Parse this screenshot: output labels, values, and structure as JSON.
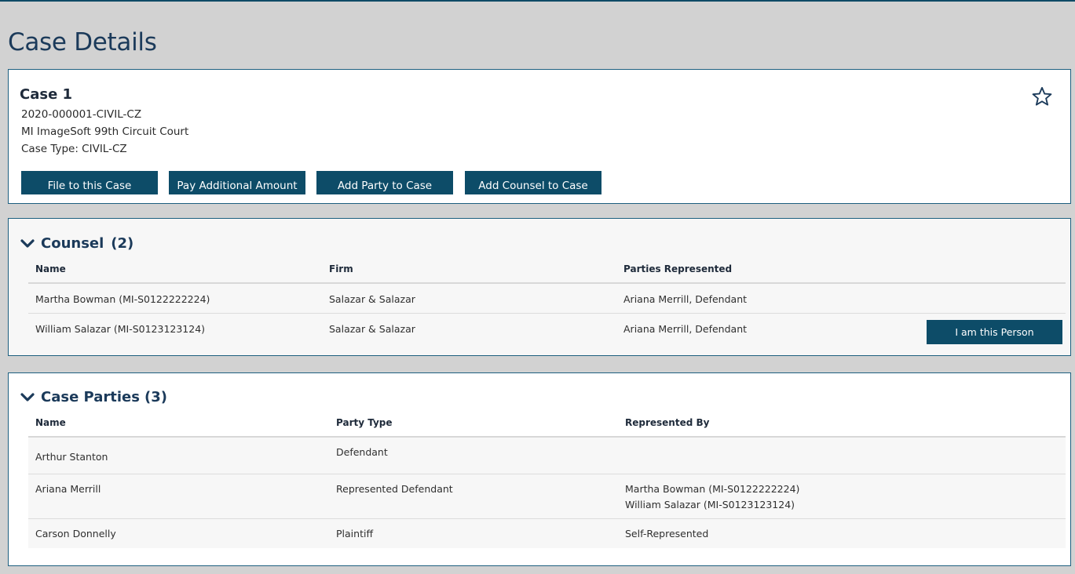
{
  "page": {
    "title": "Case Details"
  },
  "case": {
    "name": "Case 1",
    "number": "2020-000001-CIVIL-CZ",
    "court": "MI ImageSoft 99th Circuit Court",
    "type": "Case Type: CIVIL-CZ",
    "favorite_icon": "star-outline-icon",
    "actions": {
      "file": "File to this Case",
      "pay": "Pay Additional Amount",
      "add_party": "Add Party to Case",
      "add_counsel": "Add Counsel to Case"
    }
  },
  "counsel": {
    "title": "Counsel",
    "count": "(2)",
    "columns": {
      "name": "Name",
      "firm": "Firm",
      "parties": "Parties Represented"
    },
    "rows": [
      {
        "name": "Martha Bowman (MI-S0122222224)",
        "firm": "Salazar & Salazar",
        "parties": "Ariana Merrill, Defendant"
      },
      {
        "name": "William Salazar (MI-S0123123124)",
        "firm": "Salazar & Salazar",
        "parties": "Ariana Merrill, Defendant",
        "action": "I am this Person"
      }
    ]
  },
  "parties": {
    "title": "Case Parties",
    "count": "(3)",
    "columns": {
      "name": "Name",
      "type": "Party Type",
      "represented_by": "Represented By"
    },
    "rows": [
      {
        "name": "Arthur Stanton",
        "type": "Defendant",
        "represented_by": []
      },
      {
        "name": "Ariana Merrill",
        "type": "Represented Defendant",
        "represented_by": [
          "Martha Bowman (MI-S0122222224)",
          "William Salazar (MI-S0123123124)"
        ]
      },
      {
        "name": "Carson Donnelly",
        "type": "Plaintiff",
        "represented_by": [
          "Self-Represented"
        ]
      }
    ]
  },
  "colors": {
    "primary": "#0d4c68",
    "heading": "#1b3a5a",
    "background": "#d2d2d2"
  }
}
